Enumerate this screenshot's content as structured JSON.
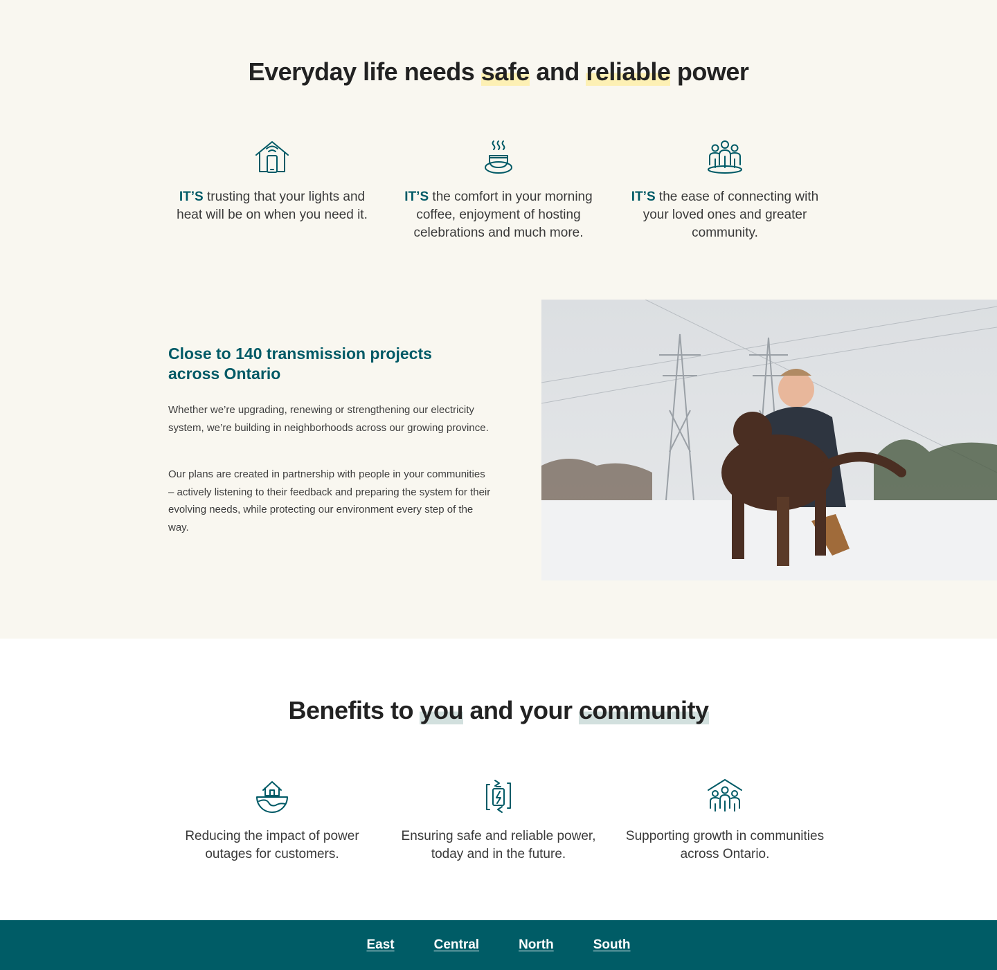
{
  "hero": {
    "title_pre": "Everyday life needs ",
    "title_hl1": "safe",
    "title_mid": " and ",
    "title_hl2": "reliable",
    "title_post": " power"
  },
  "values": [
    {
      "icon": "smart-home-phone-icon",
      "lead": "IT’S",
      "text": " trusting that your lights and heat will be on when you need it."
    },
    {
      "icon": "coffee-cup-icon",
      "lead": "IT’S",
      "text": " the comfort in your morning coffee, enjoyment of hosting celebrations and much more."
    },
    {
      "icon": "community-people-icon",
      "lead": "IT’S",
      "text": " the ease of connecting with your loved ones and greater community."
    }
  ],
  "projects": {
    "title": "Close to 140 transmission projects across Ontario",
    "p1": "Whether we’re upgrading, renewing or strengthening our electricity system, we’re building in neighborhoods across our growing province.",
    "p2": "Our plans are created in partnership with people in your communities – actively listening to their feedback and preparing the system for their evolving needs, while protecting our environment every step of the way."
  },
  "benefits": {
    "title_pre": "Benefits to ",
    "title_hl1": "you",
    "title_mid": " and your ",
    "title_hl2": "community",
    "items": [
      {
        "icon": "house-globe-icon",
        "text": "Reducing the impact of power outages for customers."
      },
      {
        "icon": "battery-cycle-icon",
        "text": "Ensuring safe and reliable power, today and in the future."
      },
      {
        "icon": "community-house-icon",
        "text": "Supporting growth in communities across Ontario."
      }
    ]
  },
  "footer_links": [
    "East",
    "Central",
    "North",
    "South"
  ],
  "colors": {
    "teal": "#005c66",
    "cream": "#f9f7f0",
    "highlight_yellow": "#fdf0b4",
    "highlight_teal": "#d2e0de"
  }
}
